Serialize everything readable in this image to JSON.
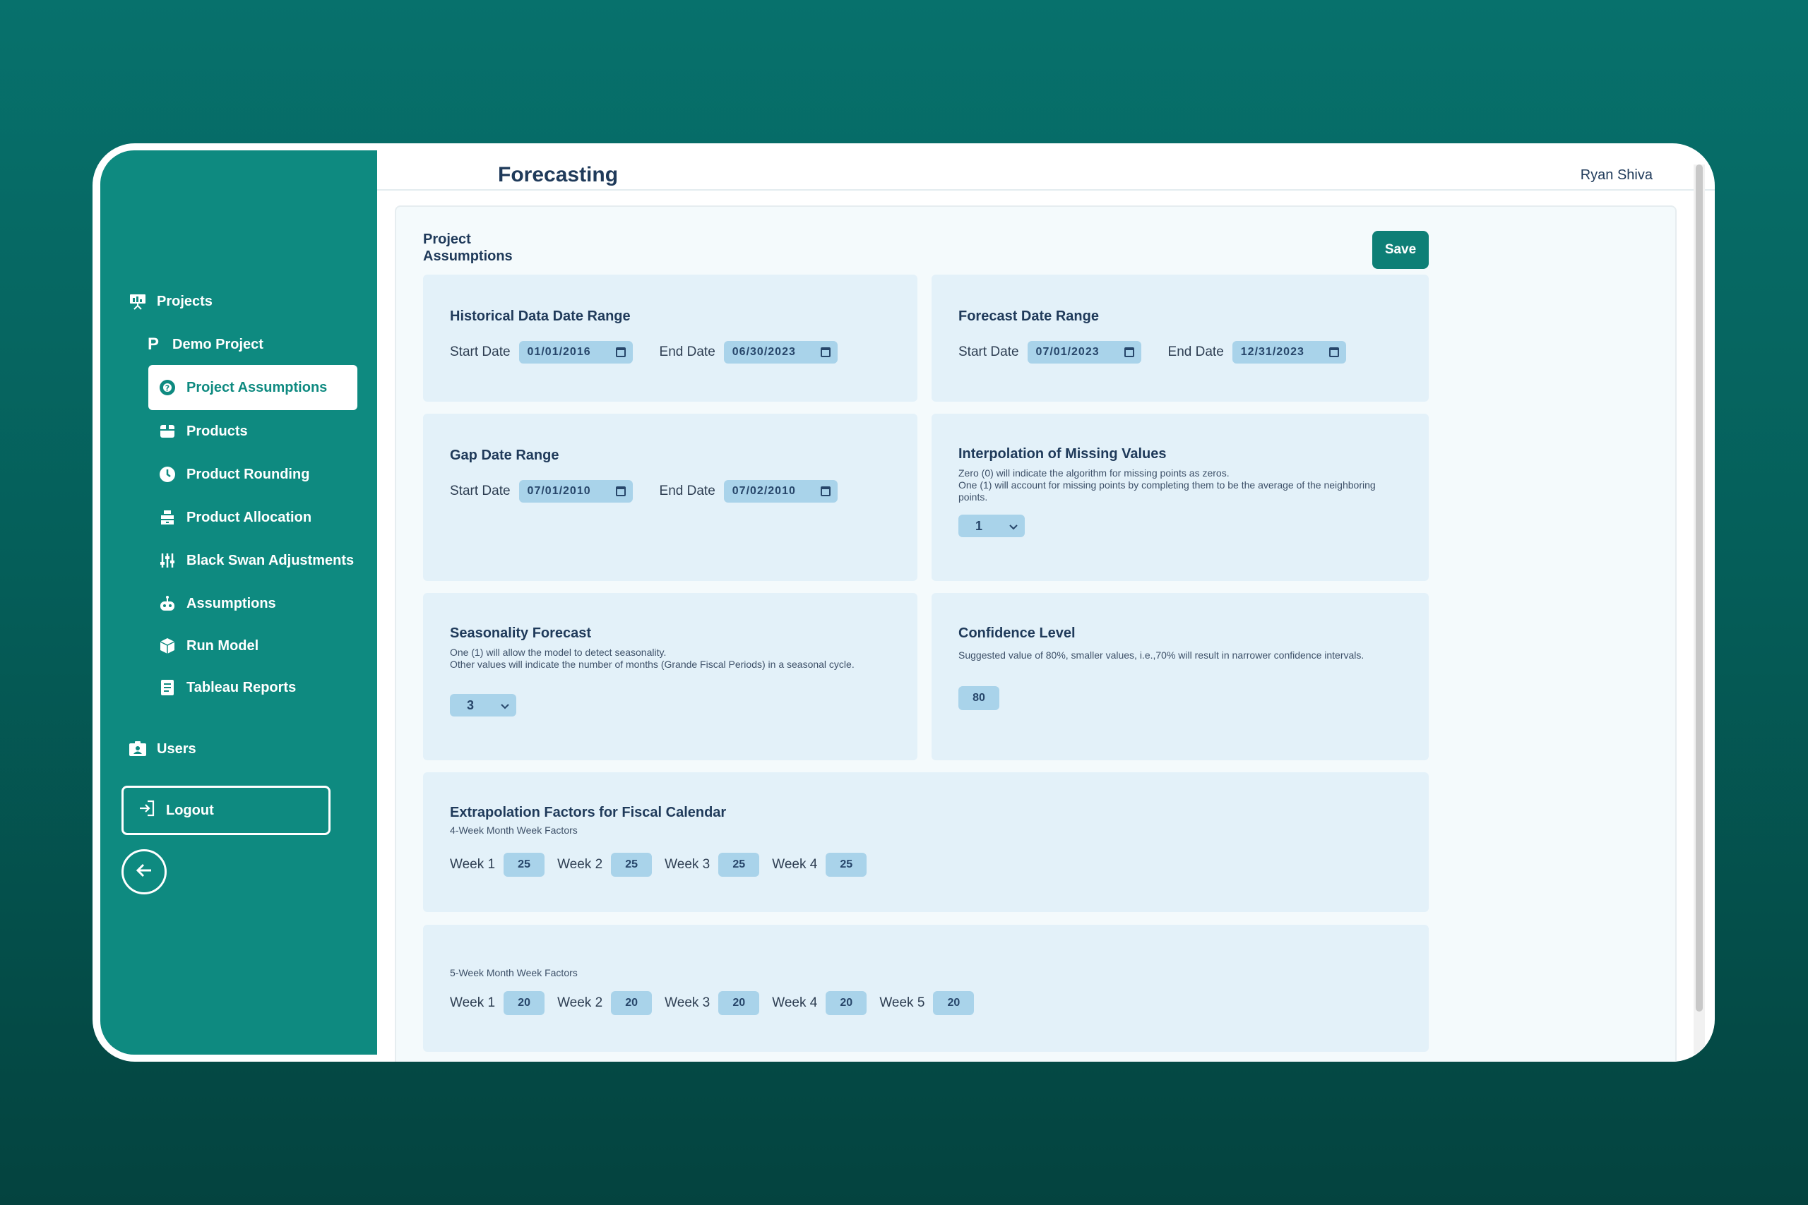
{
  "app": {
    "title": "Forecasting",
    "user": "Ryan Shiva"
  },
  "sidebar": {
    "projects_label": "Projects",
    "project_name": "Demo Project",
    "items": [
      {
        "label": "Project Assumptions",
        "icon": "gear-question-icon"
      },
      {
        "label": "Products",
        "icon": "box-icon"
      },
      {
        "label": "Product Rounding",
        "icon": "clock-icon"
      },
      {
        "label": "Product Allocation",
        "icon": "stack-icon"
      },
      {
        "label": "Black Swan Adjustments",
        "icon": "sliders-icon"
      },
      {
        "label": "Assumptions",
        "icon": "robot-icon"
      },
      {
        "label": "Run Model",
        "icon": "cube-icon"
      },
      {
        "label": "Tableau Reports",
        "icon": "document-icon"
      }
    ],
    "users_label": "Users",
    "logout_label": "Logout"
  },
  "section": {
    "title": "Project Assumptions",
    "save_label": "Save"
  },
  "historical": {
    "title": "Historical Data Date Range",
    "start_label": "Start Date",
    "start": "01/01/2016",
    "end_label": "End Date",
    "end": "06/30/2023"
  },
  "forecast": {
    "title": "Forecast Date Range",
    "start_label": "Start Date",
    "start": "07/01/2023",
    "end_label": "End Date",
    "end": "12/31/2023"
  },
  "gap": {
    "title": "Gap Date Range",
    "start_label": "Start Date",
    "start": "07/01/2010",
    "end_label": "End Date",
    "end": "07/02/2010"
  },
  "interpolation": {
    "title": "Interpolation of Missing Values",
    "desc1": "Zero (0) will indicate the algorithm for missing points as zeros.",
    "desc2": "One (1) will account for missing points by completing them to be the average of the neighboring points.",
    "value": "1"
  },
  "seasonality": {
    "title": "Seasonality Forecast",
    "desc1": "One (1) will allow the model to detect seasonality.",
    "desc2": "Other values will indicate the number of months (Grande Fiscal Periods) in a seasonal cycle.",
    "value": "3"
  },
  "confidence": {
    "title": "Confidence Level",
    "desc": "Suggested value of 80%, smaller values, i.e.,70% will result in narrower confidence intervals.",
    "value": "80"
  },
  "extrapolation": {
    "title": "Extrapolation Factors for Fiscal Calendar",
    "four_week_label": "4-Week Month Week Factors",
    "four_week": [
      {
        "label": "Week 1",
        "value": "25"
      },
      {
        "label": "Week 2",
        "value": "25"
      },
      {
        "label": "Week 3",
        "value": "25"
      },
      {
        "label": "Week 4",
        "value": "25"
      }
    ],
    "five_week_label": "5-Week Month Week Factors",
    "five_week": [
      {
        "label": "Week 1",
        "value": "20"
      },
      {
        "label": "Week 2",
        "value": "20"
      },
      {
        "label": "Week 3",
        "value": "20"
      },
      {
        "label": "Week 4",
        "value": "20"
      },
      {
        "label": "Week 5",
        "value": "20"
      }
    ]
  },
  "colors": {
    "sidebar": "#0e8a80",
    "accent": "#0e7f76",
    "card": "#e3f1f9",
    "field": "#a9d3ea",
    "text": "#1f3a5a"
  }
}
